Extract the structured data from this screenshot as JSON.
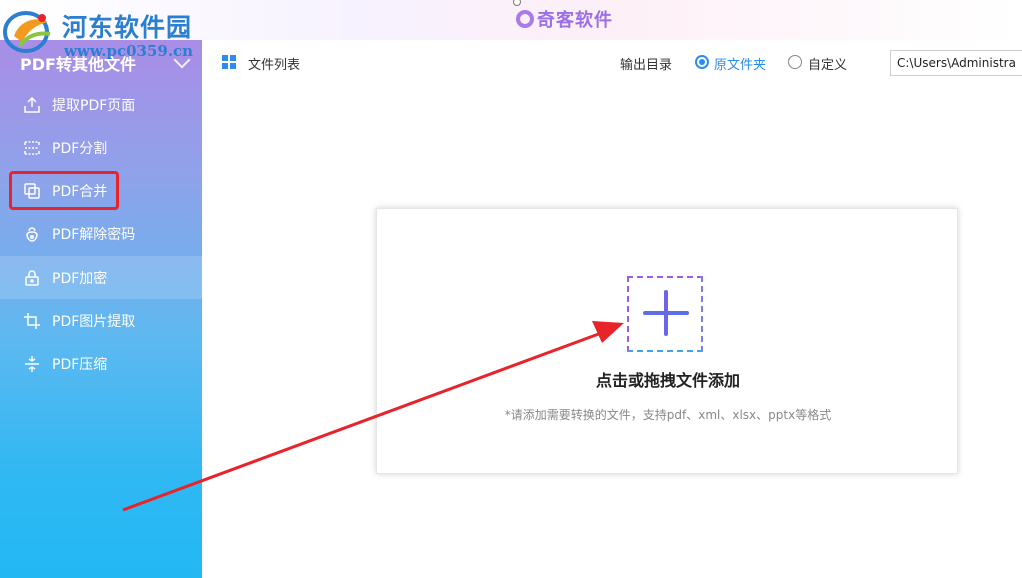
{
  "watermark": {
    "title": "河东软件园",
    "url": "www.pc0359.cn"
  },
  "app": {
    "brand": "奇客软件"
  },
  "sidebar": {
    "header": "PDF转其他文件",
    "items": [
      {
        "label": "提取PDF页面",
        "icon": "export-page-icon"
      },
      {
        "label": "PDF分割",
        "icon": "split-icon"
      },
      {
        "label": "PDF合并",
        "icon": "merge-icon"
      },
      {
        "label": "PDF解除密码",
        "icon": "unlock-icon"
      },
      {
        "label": "PDF加密",
        "icon": "lock-icon"
      },
      {
        "label": "PDF图片提取",
        "icon": "crop-icon"
      },
      {
        "label": "PDF压缩",
        "icon": "compress-icon"
      }
    ]
  },
  "toolbar": {
    "file_list_label": "文件列表",
    "output_label": "输出目录",
    "option_source": "原文件夹",
    "option_custom": "自定义",
    "selected_option": "原文件夹",
    "path_value": "C:\\Users\\Administra"
  },
  "dropzone": {
    "title": "点击或拖拽文件添加",
    "hint": "*请添加需要转换的文件，支持pdf、xml、xlsx、pptx等格式"
  },
  "colors": {
    "accent": "#2d8cf0",
    "highlight": "#e8242b",
    "sidebar_top": "#a98de6",
    "sidebar_bottom": "#22b8f4"
  }
}
